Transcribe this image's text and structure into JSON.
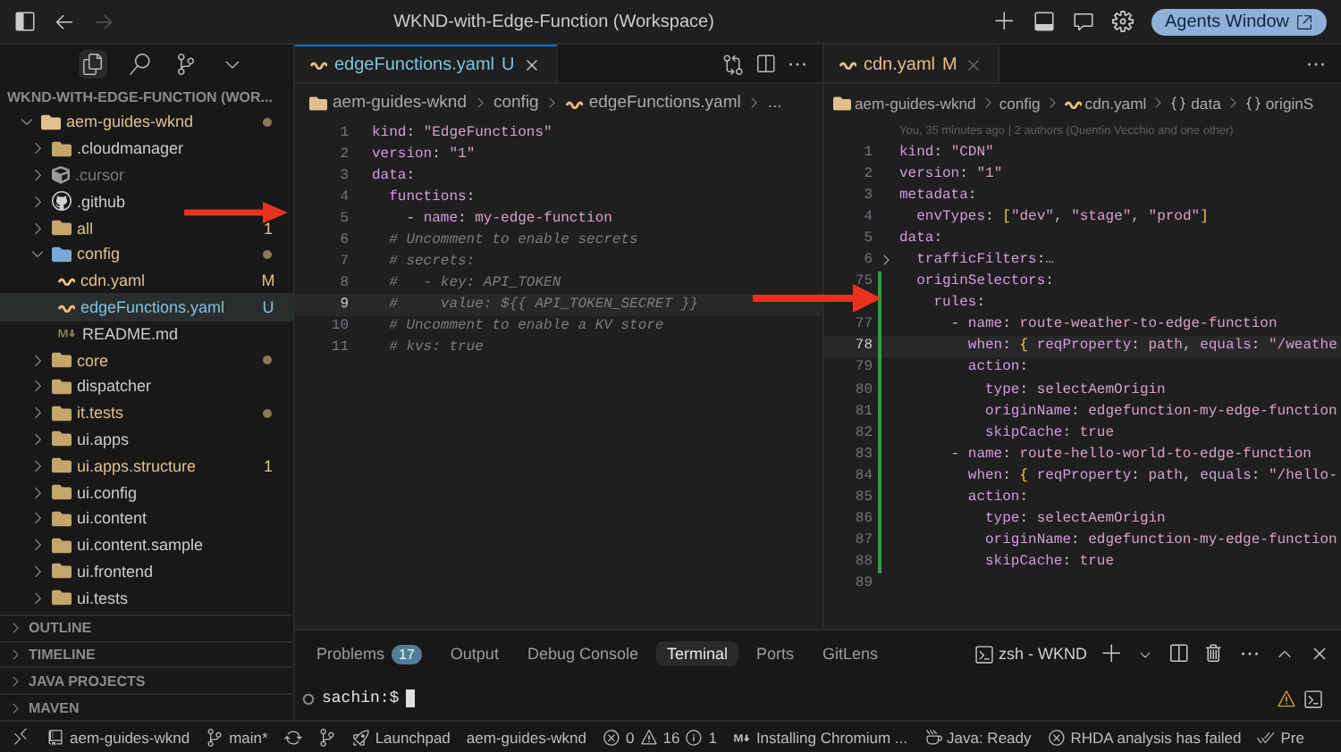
{
  "window": {
    "title": "WKND-with-Edge-Function (Workspace)",
    "agents_button": "Agents Window"
  },
  "explorer": {
    "title": "WKND-WITH-EDGE-FUNCTION (WOR...",
    "tree": [
      {
        "name": "aem-guides-wknd",
        "kind": "project",
        "expanded": true,
        "selected": false,
        "color": "#e2c08d",
        "dot": true,
        "children": [
          {
            "name": ".cloudmanager",
            "kind": "folder",
            "expanded": false,
            "selected": false,
            "color": "#cccccc",
            "dot": false
          },
          {
            "name": ".cursor",
            "kind": "cube-folder",
            "expanded": false,
            "selected": false,
            "color": "#7a7a7a",
            "dot": false
          },
          {
            "name": ".github",
            "kind": "github-folder",
            "expanded": false,
            "selected": false,
            "color": "#cccccc",
            "dot": false
          },
          {
            "name": "all",
            "kind": "folder",
            "expanded": false,
            "selected": false,
            "color": "#e2c08d",
            "badge": "1",
            "dot": false
          },
          {
            "name": "config",
            "kind": "config-folder",
            "expanded": true,
            "selected": false,
            "color": "#e2c08d",
            "dot": true,
            "children": [
              {
                "name": "cdn.yaml",
                "kind": "yaml-file",
                "selected": false,
                "color": "#e2c08d",
                "badge": "M",
                "dot": false
              },
              {
                "name": "edgeFunctions.yaml",
                "kind": "yaml-file",
                "selected": true,
                "color": "#7fc3e0",
                "badge": "U",
                "dot": false
              },
              {
                "name": "README.md",
                "kind": "markdown-file",
                "selected": false,
                "color": "#cccccc",
                "dot": false
              }
            ]
          },
          {
            "name": "core",
            "kind": "folder",
            "expanded": false,
            "selected": false,
            "color": "#e2c08d",
            "dot": true
          },
          {
            "name": "dispatcher",
            "kind": "folder",
            "expanded": false,
            "selected": false,
            "color": "#cccccc",
            "dot": false
          },
          {
            "name": "it.tests",
            "kind": "folder",
            "expanded": false,
            "selected": false,
            "color": "#e2c08d",
            "dot": true
          },
          {
            "name": "ui.apps",
            "kind": "folder",
            "expanded": false,
            "selected": false,
            "color": "#cccccc",
            "dot": false
          },
          {
            "name": "ui.apps.structure",
            "kind": "folder",
            "expanded": false,
            "selected": false,
            "color": "#e2c08d",
            "badge": "1",
            "dot": false
          },
          {
            "name": "ui.config",
            "kind": "folder",
            "expanded": false,
            "selected": false,
            "color": "#cccccc",
            "dot": false
          },
          {
            "name": "ui.content",
            "kind": "folder",
            "expanded": false,
            "selected": false,
            "color": "#cccccc",
            "dot": false
          },
          {
            "name": "ui.content.sample",
            "kind": "folder",
            "expanded": false,
            "selected": false,
            "color": "#cccccc",
            "dot": false
          },
          {
            "name": "ui.frontend",
            "kind": "folder",
            "expanded": false,
            "selected": false,
            "color": "#cccccc",
            "dot": false
          },
          {
            "name": "ui.tests",
            "kind": "folder",
            "expanded": false,
            "selected": false,
            "color": "#cccccc",
            "dot": false
          }
        ]
      }
    ],
    "sections": [
      "OUTLINE",
      "TIMELINE",
      "JAVA PROJECTS",
      "MAVEN"
    ]
  },
  "editors": [
    {
      "tab": {
        "name": "edgeFunctions.yaml",
        "badge": "U",
        "color": "#7fc3e0",
        "selected": true
      },
      "breadcrumbs": [
        {
          "kind": "project",
          "label": "aem-guides-wknd"
        },
        {
          "kind": "folder",
          "label": "config"
        },
        {
          "kind": "yaml-file",
          "label": "edgeFunctions.yaml"
        },
        {
          "kind": "more",
          "label": "..."
        }
      ],
      "lines": [
        {
          "num": "1",
          "current": false,
          "changed": false,
          "text": "kind: \"EdgeFunctions\""
        },
        {
          "num": "2",
          "current": false,
          "changed": false,
          "text": "version: \"1\""
        },
        {
          "num": "3",
          "current": false,
          "changed": false,
          "text": "data:"
        },
        {
          "num": "4",
          "current": false,
          "changed": false,
          "text": "  functions:"
        },
        {
          "num": "5",
          "current": false,
          "changed": false,
          "text": "    - name: my-edge-function"
        },
        {
          "num": "6",
          "current": false,
          "changed": false,
          "text": "  # Uncomment to enable secrets"
        },
        {
          "num": "7",
          "current": false,
          "changed": false,
          "text": "  # secrets:"
        },
        {
          "num": "8",
          "current": false,
          "changed": false,
          "text": "  #   - key: API_TOKEN"
        },
        {
          "num": "9",
          "current": true,
          "changed": false,
          "text": "  #     value: ${{ API_TOKEN_SECRET }}"
        },
        {
          "num": "10",
          "current": false,
          "changed": false,
          "text": "  # Uncomment to enable a KV store"
        },
        {
          "num": "11",
          "current": false,
          "changed": false,
          "text": "  # kvs: true"
        }
      ]
    },
    {
      "tab": {
        "name": "cdn.yaml",
        "badge": "M",
        "color": "#e2c08d",
        "selected": false
      },
      "breadcrumbs": [
        {
          "kind": "project",
          "label": "aem-guides-wknd"
        },
        {
          "kind": "folder",
          "label": "config"
        },
        {
          "kind": "yaml-file",
          "label": "cdn.yaml"
        },
        {
          "kind": "object",
          "label": "data"
        },
        {
          "kind": "object",
          "label": "originS"
        }
      ],
      "blame": "You, 35 minutes ago | 2 authors (Quentin Vecchio and one other)",
      "lines": [
        {
          "num": "1",
          "current": false,
          "changed": false,
          "text": "kind: \"CDN\""
        },
        {
          "num": "2",
          "current": false,
          "changed": false,
          "text": "version: \"1\""
        },
        {
          "num": "3",
          "current": false,
          "changed": false,
          "text": "metadata:"
        },
        {
          "num": "4",
          "current": false,
          "changed": false,
          "text": "  envTypes: [\"dev\", \"stage\", \"prod\"]"
        },
        {
          "num": "5",
          "current": false,
          "changed": false,
          "text": "data:"
        },
        {
          "num": "6",
          "current": false,
          "changed": false,
          "folded": true,
          "text": "  trafficFilters:…"
        },
        {
          "num": "75",
          "current": false,
          "changed": true,
          "text": "  originSelectors:"
        },
        {
          "current": false,
          "changed": true,
          "text": "    rules:"
        },
        {
          "num": "77",
          "current": false,
          "changed": true,
          "text": "      - name: route-weather-to-edge-function"
        },
        {
          "num": "78",
          "current": true,
          "changed": true,
          "text": "        when: { reqProperty: path, equals: \"/weathe"
        },
        {
          "num": "79",
          "current": false,
          "changed": true,
          "text": "        action:"
        },
        {
          "num": "80",
          "current": false,
          "changed": true,
          "text": "          type: selectAemOrigin"
        },
        {
          "num": "81",
          "current": false,
          "changed": true,
          "text": "          originName: edgefunction-my-edge-function"
        },
        {
          "num": "82",
          "current": false,
          "changed": true,
          "text": "          skipCache: true"
        },
        {
          "num": "83",
          "current": false,
          "changed": true,
          "text": "      - name: route-hello-world-to-edge-function"
        },
        {
          "num": "84",
          "current": false,
          "changed": true,
          "text": "        when: { reqProperty: path, equals: \"/hello-"
        },
        {
          "num": "85",
          "current": false,
          "changed": true,
          "text": "        action:"
        },
        {
          "num": "86",
          "current": false,
          "changed": true,
          "text": "          type: selectAemOrigin"
        },
        {
          "num": "87",
          "current": false,
          "changed": true,
          "text": "          originName: edgefunction-my-edge-function"
        },
        {
          "num": "88",
          "current": false,
          "changed": true,
          "text": "          skipCache: true"
        },
        {
          "num": "89",
          "current": false,
          "changed": false
        }
      ]
    }
  ],
  "panel": {
    "tabs": [
      {
        "label": "Problems",
        "badge": "17",
        "selected": false
      },
      {
        "label": "Output",
        "selected": false
      },
      {
        "label": "Debug Console",
        "selected": false
      },
      {
        "label": "Terminal",
        "selected": true
      },
      {
        "label": "Ports",
        "selected": false
      },
      {
        "label": "GitLens",
        "selected": false
      }
    ],
    "terminal": {
      "name": "zsh - WKND",
      "prompt": "sachin:$"
    }
  },
  "status_bar": {
    "repo": "aem-guides-wknd",
    "branch": "main*",
    "launchpad": "Launchpad",
    "workspace": "aem-guides-wknd",
    "errors": "0",
    "warnings": "16",
    "infos": "1",
    "task": "Installing Chromium ...",
    "java": "Java: Ready",
    "rhda": "RHDA analysis has failed",
    "extra": "Pre"
  }
}
